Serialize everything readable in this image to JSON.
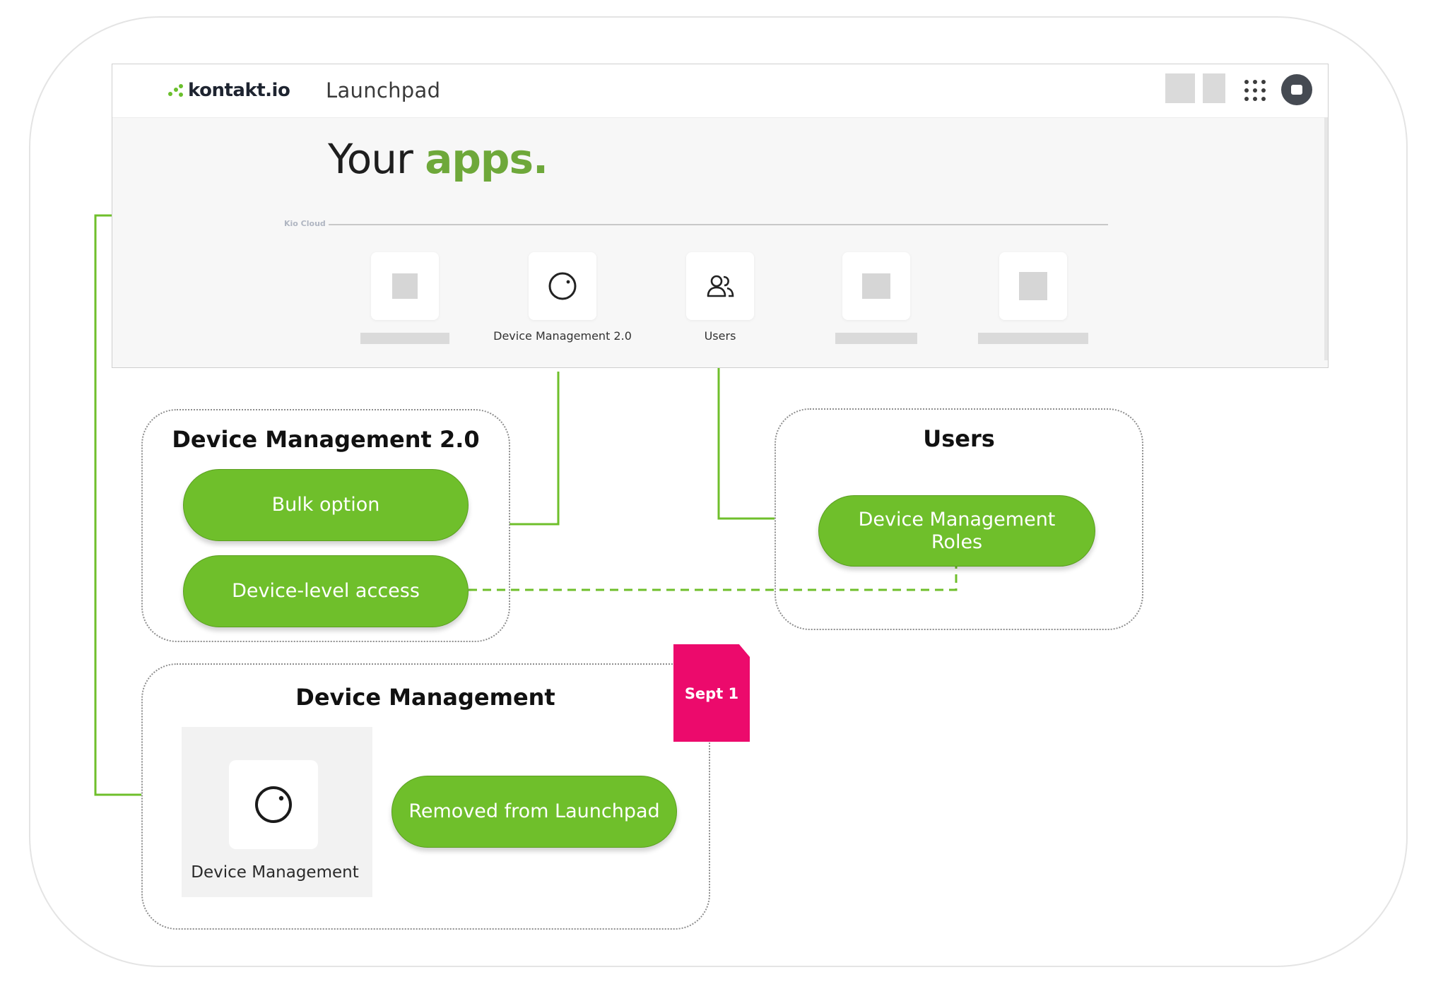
{
  "brand": {
    "logo_text": "kontakt.io",
    "app_title": "Launchpad",
    "accent": "#6fbf2b",
    "badge_color": "#ec0a6c"
  },
  "launchpad": {
    "headline_part1": "Your",
    "headline_part2": "apps.",
    "section_label": "Kio Cloud",
    "apps": [
      {
        "label": "",
        "icon": "placeholder-icon"
      },
      {
        "label": "Device Management 2.0",
        "icon": "device-icon"
      },
      {
        "label": "Users",
        "icon": "users-icon"
      },
      {
        "label": "",
        "icon": "placeholder-icon"
      },
      {
        "label": "",
        "icon": "placeholder-icon"
      }
    ]
  },
  "boxes": {
    "dm2": {
      "title": "Device Management 2.0",
      "features": [
        "Bulk option",
        "Device-level access"
      ]
    },
    "users": {
      "title": "Users",
      "features": [
        "Device Management Roles"
      ]
    },
    "dm": {
      "title": "Device Management",
      "app_label": "Device Management",
      "action": "Removed from Launchpad",
      "badge": "Sept 1"
    }
  }
}
